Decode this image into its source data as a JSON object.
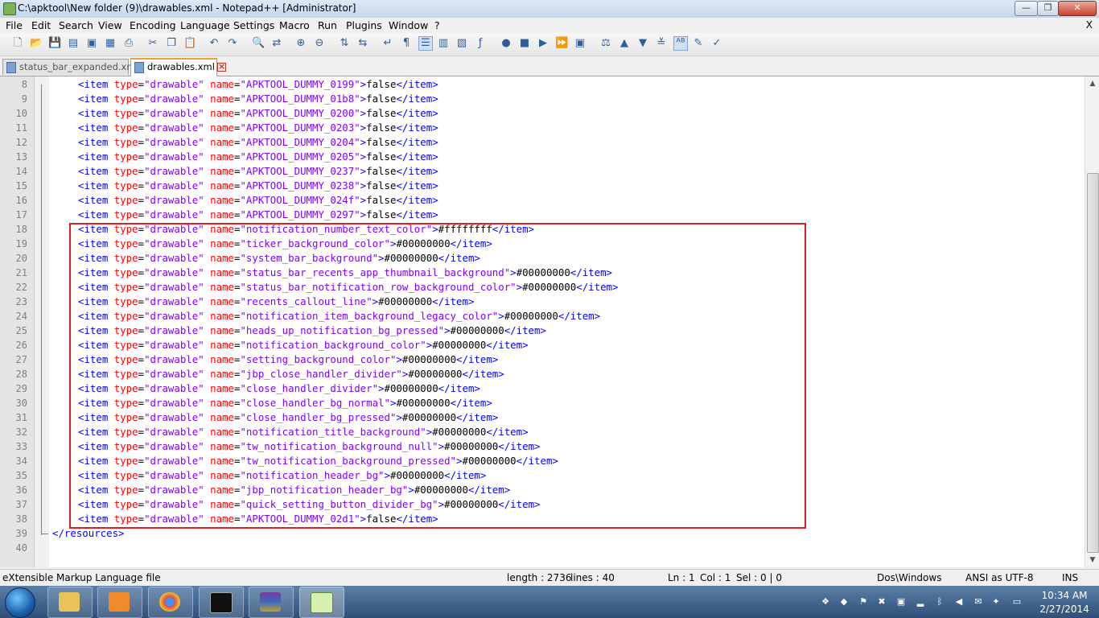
{
  "window": {
    "title": "C:\\apktool\\New folder (9)\\drawables.xml - Notepad++ [Administrator]"
  },
  "menu": {
    "items": [
      "File",
      "Edit",
      "Search",
      "View",
      "Encoding",
      "Language",
      "Settings",
      "Macro",
      "Run",
      "Plugins",
      "Window",
      "?"
    ],
    "close": "X"
  },
  "tabs": [
    {
      "label": "status_bar_expanded.xml"
    },
    {
      "label": "drawables.xml"
    }
  ],
  "editor": {
    "lines": [
      {
        "n": "8",
        "name": "APKTOOL_DUMMY_0199",
        "val": "false"
      },
      {
        "n": "9",
        "name": "APKTOOL_DUMMY_01b8",
        "val": "false"
      },
      {
        "n": "10",
        "name": "APKTOOL_DUMMY_0200",
        "val": "false"
      },
      {
        "n": "11",
        "name": "APKTOOL_DUMMY_0203",
        "val": "false"
      },
      {
        "n": "12",
        "name": "APKTOOL_DUMMY_0204",
        "val": "false"
      },
      {
        "n": "13",
        "name": "APKTOOL_DUMMY_0205",
        "val": "false"
      },
      {
        "n": "14",
        "name": "APKTOOL_DUMMY_0237",
        "val": "false"
      },
      {
        "n": "15",
        "name": "APKTOOL_DUMMY_0238",
        "val": "false"
      },
      {
        "n": "16",
        "name": "APKTOOL_DUMMY_024f",
        "val": "false"
      },
      {
        "n": "17",
        "name": "APKTOOL_DUMMY_0297",
        "val": "false"
      },
      {
        "n": "18",
        "name": "notification_number_text_color",
        "val": "#ffffffff"
      },
      {
        "n": "19",
        "name": "ticker_background_color",
        "val": "#00000000"
      },
      {
        "n": "20",
        "name": "system_bar_background",
        "val": "#00000000"
      },
      {
        "n": "21",
        "name": "status_bar_recents_app_thumbnail_background",
        "val": "#00000000"
      },
      {
        "n": "22",
        "name": "status_bar_notification_row_background_color",
        "val": "#00000000"
      },
      {
        "n": "23",
        "name": "recents_callout_line",
        "val": "#00000000"
      },
      {
        "n": "24",
        "name": "notification_item_background_legacy_color",
        "val": "#00000000"
      },
      {
        "n": "25",
        "name": "heads_up_notification_bg_pressed",
        "val": "#00000000"
      },
      {
        "n": "26",
        "name": "notification_background_color",
        "val": "#00000000"
      },
      {
        "n": "27",
        "name": "setting_background_color",
        "val": "#00000000"
      },
      {
        "n": "28",
        "name": "jbp_close_handler_divider",
        "val": "#00000000"
      },
      {
        "n": "29",
        "name": "close_handler_divider",
        "val": "#00000000"
      },
      {
        "n": "30",
        "name": "close_handler_bg_normal",
        "val": "#00000000"
      },
      {
        "n": "31",
        "name": "close_handler_bg_pressed",
        "val": "#00000000"
      },
      {
        "n": "32",
        "name": "notification_title_background",
        "val": "#00000000"
      },
      {
        "n": "33",
        "name": "tw_notification_background_null",
        "val": "#00000000"
      },
      {
        "n": "34",
        "name": "tw_notification_background_pressed",
        "val": "#00000000"
      },
      {
        "n": "35",
        "name": "notification_header_bg",
        "val": "#00000000"
      },
      {
        "n": "36",
        "name": "jbp_notification_header_bg",
        "val": "#00000000"
      },
      {
        "n": "37",
        "name": "quick_setting_button_divider_bg",
        "val": "#00000000"
      },
      {
        "n": "38",
        "name": "APKTOOL_DUMMY_02d1",
        "val": "false"
      }
    ],
    "line39": {
      "n": "39",
      "text": "</resources>"
    },
    "line40": {
      "n": "40"
    },
    "item_type": "drawable"
  },
  "status": {
    "filetype": "eXtensible Markup Language file",
    "length": "length : 2736",
    "lines": "lines : 40",
    "ln": "Ln : 1",
    "col": "Col : 1",
    "sel": "Sel : 0 | 0",
    "eol": "Dos\\Windows",
    "encoding": "ANSI as UTF-8",
    "mode": "INS"
  },
  "taskbar": {
    "time": "10:34 AM",
    "date": "2/27/2014"
  },
  "colors": {
    "tag": "#0000ff",
    "attr": "#ff0000",
    "value": "#8000ff",
    "highlight": "#e02020"
  }
}
